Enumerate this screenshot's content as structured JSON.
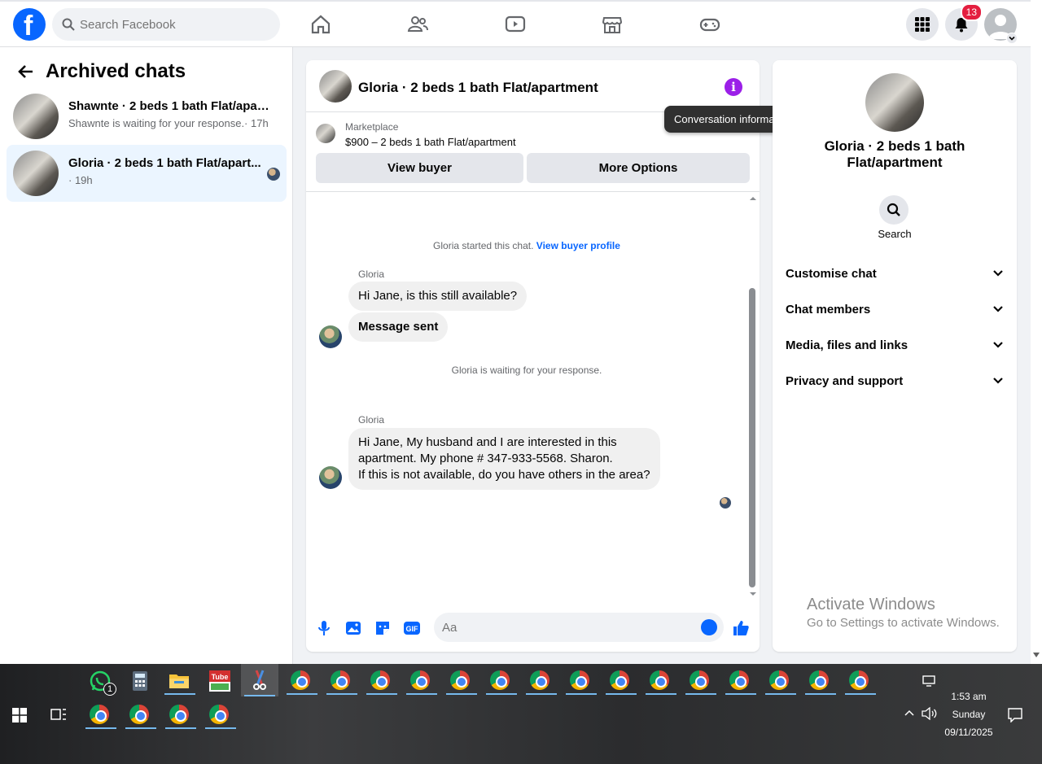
{
  "topbar": {
    "search_placeholder": "Search Facebook",
    "notification_count": "13",
    "icons": [
      "home-icon",
      "friends-icon",
      "watch-icon",
      "marketplace-icon",
      "gaming-icon",
      "menu-grid-icon",
      "bell-icon",
      "account-avatar"
    ]
  },
  "sidebar": {
    "title": "Archived chats",
    "chats": [
      {
        "name": "Shawnte · 2 beds 1 bath Flat/apart...",
        "sub": "Shawnte is waiting for your response.· 17h"
      },
      {
        "name": "Gloria · 2 beds 1 bath Flat/apart...",
        "sub": "· 19h"
      }
    ]
  },
  "chat": {
    "title": "Gloria · 2 beds 1 bath Flat/apartment",
    "marketplace_label": "Marketplace",
    "listing": "$900 – 2 beds 1 bath Flat/apartment",
    "view_buyer": "View buyer",
    "more_options": "More Options",
    "started_text": "Gloria started this chat.",
    "view_buyer_profile": "View buyer profile",
    "sender1": "Gloria",
    "msg1": "Hi Jane, is this still available?",
    "msg2": "Message sent",
    "waiting": "Gloria is waiting for your response.",
    "sender2": "Gloria",
    "msg3_line1": "Hi Jane, My husband and I are interested in this",
    "msg3_line2": "apartment. My phone # 347-933-5568. Sharon.",
    "msg3_line3": "If this is not available, do you have others in the area?",
    "composer_placeholder": "Aa",
    "tooltip": "Conversation information"
  },
  "right_panel": {
    "name": "Gloria · 2 beds 1 bath Flat/apartment",
    "search_label": "Search",
    "sections": [
      "Customise chat",
      "Chat members",
      "Media, files and links",
      "Privacy and support"
    ]
  },
  "watermark": {
    "line1": "Activate Windows",
    "line2": "Go to Settings to activate Windows."
  },
  "taskbar": {
    "whatsapp_badge": "1",
    "time": "1:53 am",
    "day": "Sunday",
    "date": "09/11/2025"
  },
  "colors": {
    "accent": "#0866ff",
    "info": "#9b1fe8",
    "badge": "#e41e3f"
  }
}
